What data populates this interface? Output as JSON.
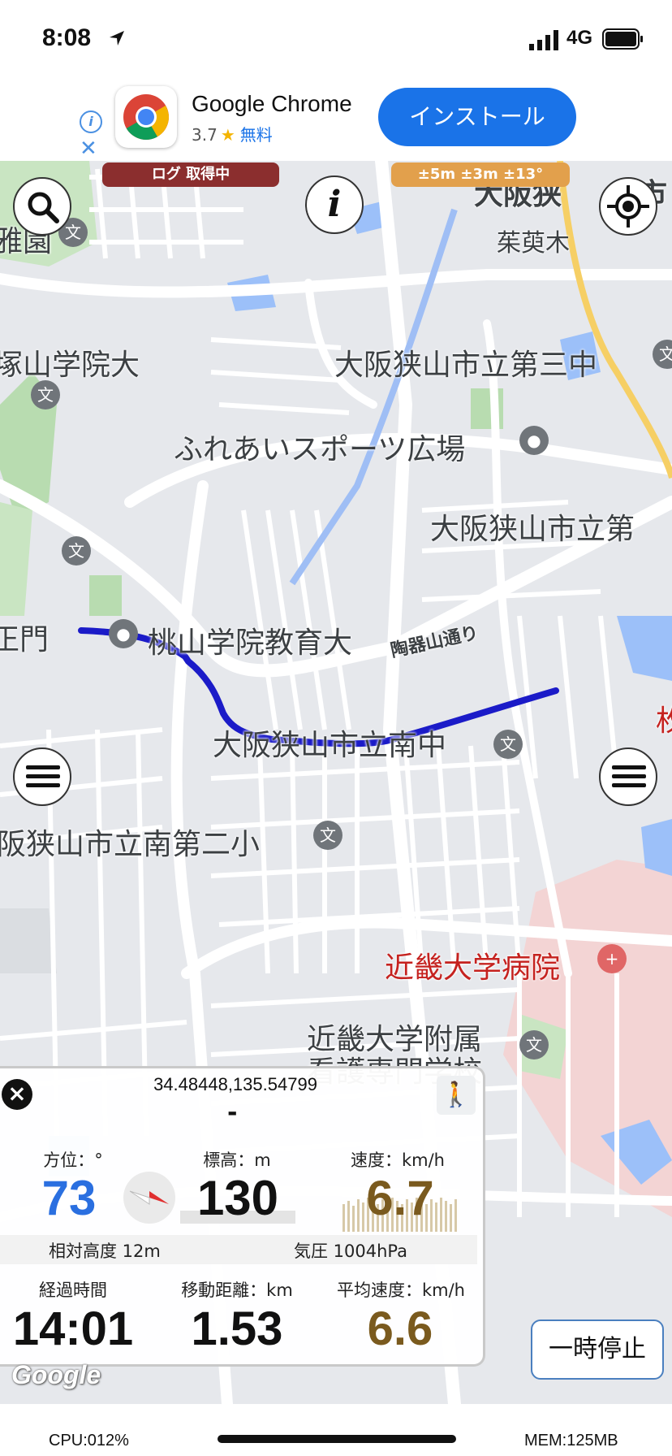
{
  "status": {
    "time": "8:08",
    "network": "4G"
  },
  "ad": {
    "app_name": "Google Chrome",
    "rating": "3.7",
    "price": "無料",
    "install_label": "インストール"
  },
  "badges": {
    "log": "ログ 取得中",
    "accuracy": "±5m ±3m ±13°"
  },
  "map_labels": [
    "大阪狭",
    "市",
    "茱萸木",
    "雅園",
    "塚山学院大",
    "大阪狭山市立第三中",
    "ふれあいスポーツ広場",
    "大阪狭山市立第",
    "正門",
    "桃山学院教育大",
    "陶器山通り",
    "大阪狭山市立南中",
    "阪狭山市立南第二小",
    "近畿大学病院",
    "近畿大学附属",
    "看護専門学校",
    "枚"
  ],
  "pin_glyph": "文",
  "info_glyph": "i",
  "panel": {
    "coords": "34.48448,135.54799",
    "address": "-",
    "bearing_label": "方位：°",
    "bearing_value": "73",
    "elevation_label": "標高：m",
    "elevation_value": "130",
    "speed_label": "速度：km/h",
    "speed_value": "6.7",
    "relative_altitude": "相対高度 12m",
    "pressure": "気圧 1004hPa",
    "elapsed_label": "経過時間",
    "elapsed_value": "14:01",
    "distance_label": "移動距離：km",
    "distance_value": "1.53",
    "avg_speed_label": "平均速度：km/h",
    "avg_speed_value": "6.6",
    "close_glyph": "×",
    "walker_icon": "🚶"
  },
  "pause_label": "一時停止",
  "google_logo": "Google",
  "footer": {
    "cpu": "CPU:012%",
    "mem": "MEM:125MB"
  },
  "colors": {
    "track": "#1b1bc8",
    "bearing": "#2a6fe0",
    "speed": "#7a5a1e",
    "install": "#1a73e8"
  }
}
